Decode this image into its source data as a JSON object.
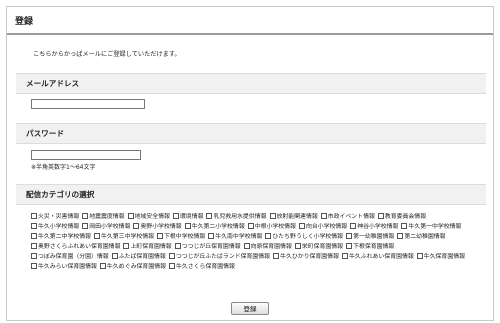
{
  "header": {
    "title": "登録"
  },
  "intro_text": "こちらからかっぱメールにご登録していただけます。",
  "email_section": {
    "heading": "メールアドレス",
    "value": ""
  },
  "password_section": {
    "heading": "パスワード",
    "value": "",
    "note": "※半角英数字1～64文字"
  },
  "category_section": {
    "heading": "配信カテゴリの選択",
    "categories": [
      "火災・災害情報",
      "地震震度情報",
      "地域安全情報",
      "環境情報",
      "乳児救用水提供情報",
      "放射能関連情報",
      "市政イベント情報",
      "教育委員会情報",
      "牛久小学校情報",
      "岡田小学校情報",
      "奥野小学校情報",
      "牛久第二小学校情報",
      "中根小学校情報",
      "向台小学校情報",
      "神谷小学校情報",
      "牛久第一中学校情報",
      "牛久第二中学校情報",
      "牛久第三中学校情報",
      "下根中学校情報",
      "牛久南中学校情報",
      "ひたち野うしく小学校情報",
      "第一幼稚園情報",
      "第二幼稚園情報",
      "奥野さくらふれあい保育園情報",
      "上町保育園情報",
      "つつじが丘保育園情報",
      "向原保育園情報",
      "栄町保育園情報",
      "下根保育園情報",
      "つぼみ保育園（分園）情報",
      "ふたば保育園情報",
      "つつじが丘ふたばランド保育園情報",
      "牛久ひかり保育園情報",
      "牛久ふれあい保育園情報",
      "牛久保育園情報",
      "牛久みらい保育園情報",
      "牛久めぐみ保育園情報",
      "牛久さくら保育園情報"
    ]
  },
  "submit_label": "登録"
}
